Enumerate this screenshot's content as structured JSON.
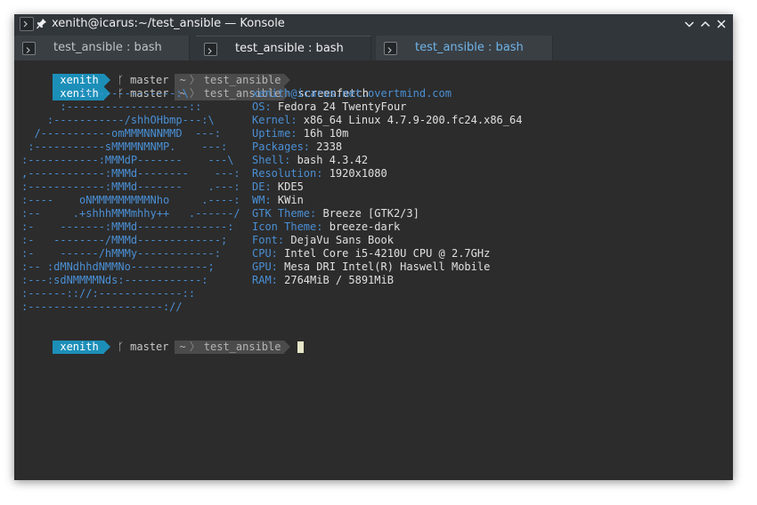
{
  "window": {
    "title": "xenith@icarus:~/test_ansible — Konsole"
  },
  "tabs": [
    {
      "label": "test_ansible : bash",
      "state": "inactive"
    },
    {
      "label": "test_ansible : bash",
      "state": "active"
    },
    {
      "label": "test_ansible : bash",
      "state": "highlight"
    }
  ],
  "prompt": {
    "user": "xenith",
    "git_symbol": "ᚴ",
    "branch": "master",
    "home": "~",
    "dir": "test_ansible",
    "command": "screenfetch"
  },
  "logo_lines": [
    "         /:-------------:\\",
    "      :-------------------::",
    "    :-----------/shhOHbmp---:\\",
    "  /-----------omMMMNNNMMD  ---:",
    " :-----------sMMMMNMNMP.    ---:",
    ":-----------:MMMdP-------    ---\\",
    ",------------:MMMd--------    ---:",
    ":------------:MMMd-------    .---:",
    ":----    oNMMMMMMMMMNho     .----:",
    ":--     .+shhhMMMmhhy++   .------/",
    ":-    -------:MMMd--------------:",
    ":-   --------/MMMd-------------;",
    ":-    ------/hMMMy------------:",
    ":-- :dMNdhhdNMMNo------------;",
    ":---:sdNMMMMNds:------------:",
    ":------:://:-------------::",
    ":---------------------://"
  ],
  "sysinfo": {
    "host": "xenith@icarus.net.overtmind.com",
    "rows": [
      {
        "key": "OS:",
        "value": " Fedora 24 TwentyFour"
      },
      {
        "key": "Kernel:",
        "value": " x86_64 Linux 4.7.9-200.fc24.x86_64"
      },
      {
        "key": "Uptime:",
        "value": " 16h 10m"
      },
      {
        "key": "Packages:",
        "value": " 2338"
      },
      {
        "key": "Shell:",
        "value": " bash 4.3.42"
      },
      {
        "key": "Resolution:",
        "value": " 1920x1080"
      },
      {
        "key": "DE:",
        "value": " KDE5"
      },
      {
        "key": "WM:",
        "value": " KWin"
      },
      {
        "key": "GTK Theme:",
        "value": " Breeze [GTK2/3]"
      },
      {
        "key": "Icon Theme:",
        "value": " breeze-dark"
      },
      {
        "key": "Font:",
        "value": " DejaVu Sans Book"
      },
      {
        "key": "CPU:",
        "value": " Intel Core i5-4210U CPU @ 2.7GHz"
      },
      {
        "key": "GPU:",
        "value": " Mesa DRI Intel(R) Haswell Mobile"
      },
      {
        "key": "RAM:",
        "value": " 2764MiB / 5891MiB"
      }
    ]
  },
  "colors": {
    "user_segment": "#1c8fb9",
    "dir_segment": "#4b4b4b",
    "logo_blue": "#4a8fd4",
    "terminal_bg": "#2c2c2c"
  },
  "icons": {
    "app": "konsole-icon",
    "pin": "pin-icon",
    "minimize": "chevron-down-icon",
    "maximize": "chevron-up-icon",
    "close": "close-icon"
  }
}
